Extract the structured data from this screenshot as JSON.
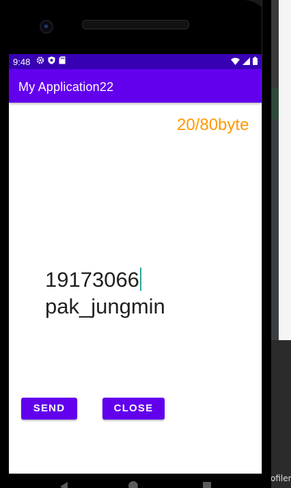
{
  "ide": {
    "profiler_label": "ofiler"
  },
  "status_bar": {
    "time": "9:48",
    "left_icons": [
      "gear-icon",
      "shield-icon",
      "sd-card-icon"
    ],
    "right_icons": [
      "wifi-icon",
      "signal-icon",
      "battery-icon"
    ]
  },
  "app_bar": {
    "title": "My Application22"
  },
  "byte_counter": "20/80byte",
  "message": {
    "line1": "19173066",
    "line2": "pak_jungmin"
  },
  "buttons": {
    "send_label": "SEND",
    "close_label": "CLOSE"
  },
  "colors": {
    "status_bar": "#3700b3",
    "primary": "#6200ee",
    "counter": "#ff9800",
    "cursor": "#26a69a"
  }
}
